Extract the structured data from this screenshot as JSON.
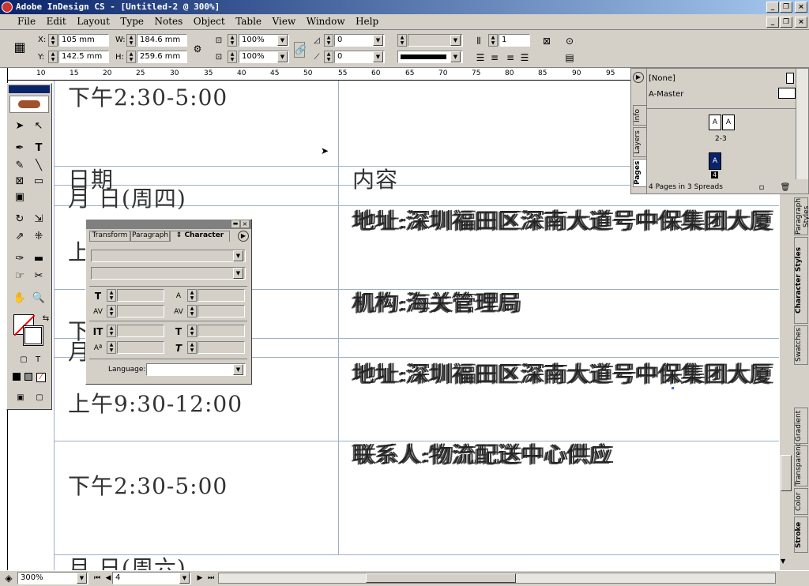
{
  "app": {
    "title": "Adobe InDesign CS - [Untitled-2 @ 300%]"
  },
  "menu": [
    "File",
    "Edit",
    "Layout",
    "Type",
    "Notes",
    "Object",
    "Table",
    "View",
    "Window",
    "Help"
  ],
  "control": {
    "x_label": "X:",
    "x": "105 mm",
    "y_label": "Y:",
    "y": "142.5 mm",
    "w_label": "W:",
    "w": "184.6 mm",
    "h_label": "H:",
    "h": "259.6 mm",
    "scale_x": "100%",
    "scale_y": "100%",
    "rotate": "0",
    "shear": "0",
    "columns": "1"
  },
  "ruler_ticks": [
    "10",
    "15",
    "20",
    "25",
    "30",
    "35",
    "40",
    "45",
    "50",
    "55",
    "60",
    "65",
    "70",
    "75",
    "80",
    "85",
    "90",
    "95"
  ],
  "doc": {
    "t1": "下午2:30-5:00",
    "t2": "日期",
    "t3": "月 日(周四)",
    "t4": "内容",
    "t5": "上",
    "t6": "地址:深圳福田区深南大道号中保集团大厦",
    "t7": "机构:海关管理局",
    "t8": "下",
    "t9": "月",
    "t10": "地址:深圳福田区深南大道号中保集团大厦",
    "t11": "上午9:30-12:00",
    "t12": "联系人:物流配送中心供应",
    "t13": "下午2:30-5:00",
    "t14": "月 日(周六)"
  },
  "pages": {
    "none": "[None]",
    "master": "A-Master",
    "spread": "2-3",
    "page_a": "A",
    "page_num": "4",
    "summary": "4 Pages in 3 Spreads",
    "tabs": [
      "Pages",
      "Layers",
      "Info"
    ]
  },
  "character": {
    "tabs": [
      "Transform",
      "Paragraph",
      "Character"
    ],
    "language_label": "Language:"
  },
  "side_tabs": [
    "Stroke",
    "Color",
    "Transparency",
    "Gradient",
    "Swatches",
    "Character Styles",
    "Paragraph Styles"
  ],
  "status": {
    "zoom": "300%",
    "page": "4"
  }
}
